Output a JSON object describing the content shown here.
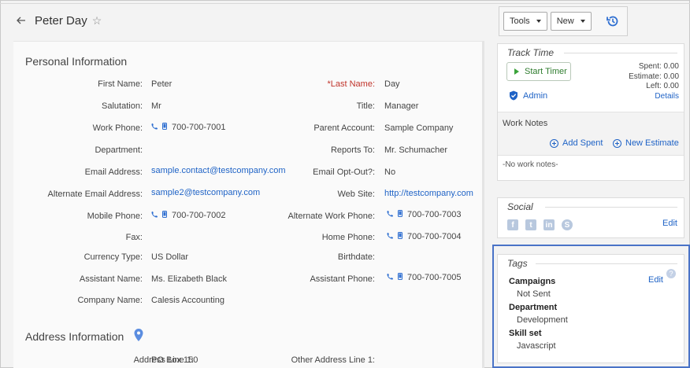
{
  "header": {
    "title": "Peter Day",
    "back_icon": "arrow-left-icon",
    "favorite_icon": "star-outline-icon"
  },
  "toolbar": {
    "tools_label": "Tools",
    "new_label": "New",
    "history_icon": "history-icon"
  },
  "personal": {
    "section_title": "Personal Information",
    "left_fields": [
      {
        "label": "First Name:",
        "value": "Peter"
      },
      {
        "label": "Salutation:",
        "value": "Mr"
      },
      {
        "label": "Work Phone:",
        "value": "700-700-7001"
      },
      {
        "label": "Department:",
        "value": ""
      },
      {
        "label": "Email Address:",
        "value": "sample.contact@testcompany.com"
      },
      {
        "label": "Alternate Email Address:",
        "value": "sample2@testcompany.com"
      },
      {
        "label": "Mobile Phone:",
        "value": "700-700-7002"
      },
      {
        "label": "Fax:",
        "value": ""
      },
      {
        "label": "Currency Type:",
        "value": "US Dollar"
      },
      {
        "label": "Assistant Name:",
        "value": "Ms. Elizabeth Black"
      },
      {
        "label": "Company Name:",
        "value": "Calesis Accounting"
      }
    ],
    "right_fields": [
      {
        "label": "Last Name:",
        "required_marker": "*",
        "value": "Day"
      },
      {
        "label": "Title:",
        "value": "Manager"
      },
      {
        "label": "Parent Account:",
        "value": "Sample Company"
      },
      {
        "label": "Reports To:",
        "value": "Mr. Schumacher"
      },
      {
        "label": "Email Opt-Out?:",
        "value": "No"
      },
      {
        "label": "Web Site:",
        "value": "http://testcompany.com"
      },
      {
        "label": "Alternate Work Phone:",
        "value": "700-700-7003"
      },
      {
        "label": "Home Phone:",
        "value": "700-700-7004"
      },
      {
        "label": "Birthdate:",
        "value": ""
      },
      {
        "label": "Assistant Phone:",
        "value": "700-700-7005"
      }
    ]
  },
  "address": {
    "section_title": "Address Information",
    "line1_label": "Address Line 1:",
    "line1_value": "PO Box 150",
    "other_line1_label": "Other Address Line 1:",
    "other_line1_value": ""
  },
  "track_time": {
    "title": "Track Time",
    "start_timer_label": "Start Timer",
    "assignee": "Admin",
    "spent": "Spent: 0.00",
    "estimate": "Estimate: 0.00",
    "left": "Left: 0.00",
    "details_label": "Details",
    "work_notes_title": "Work Notes",
    "add_spent_label": "Add Spent",
    "new_estimate_label": "New Estimate",
    "no_notes": "-No work notes-"
  },
  "social": {
    "title": "Social",
    "edit_label": "Edit",
    "icons": [
      "facebook-icon",
      "twitter-icon",
      "linkedin-icon",
      "skype-icon"
    ]
  },
  "tags": {
    "title": "Tags",
    "edit_label": "Edit",
    "groups": [
      {
        "name": "Campaigns",
        "value": "Not Sent"
      },
      {
        "name": "Department",
        "value": "Development"
      },
      {
        "name": "Skill set",
        "value": "Javascript"
      }
    ]
  },
  "colors": {
    "link": "#1f63c6",
    "required": "#c0342b",
    "highlight_border": "#4a73c7",
    "timer_green": "#3aa33a"
  }
}
